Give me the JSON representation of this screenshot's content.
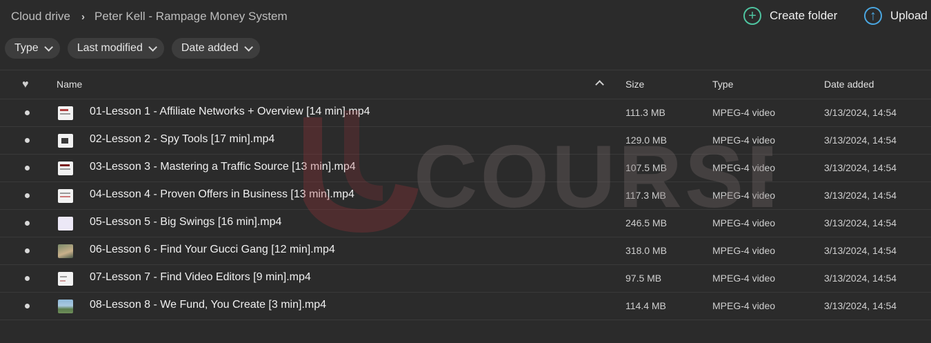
{
  "breadcrumb": {
    "root": "Cloud drive",
    "current": "Peter Kell - Rampage Money System"
  },
  "actions": {
    "create_folder": "Create folder",
    "upload": "Upload"
  },
  "filters": {
    "type": "Type",
    "last_modified": "Last modified",
    "date_added": "Date added"
  },
  "table": {
    "headers": {
      "name": "Name",
      "size": "Size",
      "type": "Type",
      "date_added": "Date added"
    },
    "rows": [
      {
        "name": "01-Lesson 1 - Affiliate Networks + Overview [14 min].mp4",
        "size": "111.3 MB",
        "type": "MPEG-4 video",
        "date": "3/13/2024, 14:54"
      },
      {
        "name": "02-Lesson 2 - Spy Tools [17 min].mp4",
        "size": "129.0 MB",
        "type": "MPEG-4 video",
        "date": "3/13/2024, 14:54"
      },
      {
        "name": "03-Lesson 3 - Mastering a Traffic Source [13 min].mp4",
        "size": "107.5 MB",
        "type": "MPEG-4 video",
        "date": "3/13/2024, 14:54"
      },
      {
        "name": "04-Lesson 4 - Proven Offers in Business [13 min].mp4",
        "size": "117.3 MB",
        "type": "MPEG-4 video",
        "date": "3/13/2024, 14:54"
      },
      {
        "name": "05-Lesson 5 - Big Swings [16 min].mp4",
        "size": "246.5 MB",
        "type": "MPEG-4 video",
        "date": "3/13/2024, 14:54"
      },
      {
        "name": "06-Lesson 6 - Find Your Gucci Gang [12 min].mp4",
        "size": "318.0 MB",
        "type": "MPEG-4 video",
        "date": "3/13/2024, 14:54"
      },
      {
        "name": "07-Lesson 7 - Find Video Editors [9 min].mp4",
        "size": "97.5 MB",
        "type": "MPEG-4 video",
        "date": "3/13/2024, 14:54"
      },
      {
        "name": "08-Lesson 8 - We Fund, You Create [3 min].mp4",
        "size": "114.4 MB",
        "type": "MPEG-4 video",
        "date": "3/13/2024, 14:54"
      }
    ]
  },
  "watermark": {
    "text": "COURSE",
    "color": "#c0392b"
  }
}
